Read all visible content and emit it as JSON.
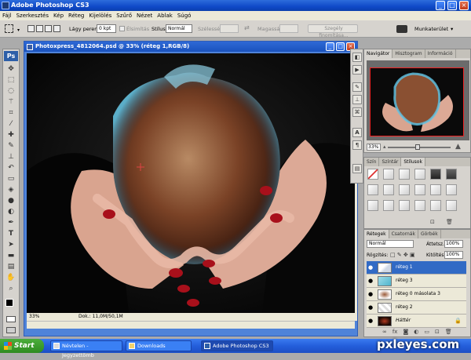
{
  "window": {
    "title": "Adobe Photoshop CS3",
    "minimize": "_",
    "maximize": "□",
    "close": "×"
  },
  "menu": [
    "Fájl",
    "Szerkesztés",
    "Kép",
    "Réteg",
    "Kijelölés",
    "Szűrő",
    "Nézet",
    "Ablak",
    "Súgó"
  ],
  "options": {
    "feather_label": "Lágy perem:",
    "feather_value": "0 kpt",
    "antialias_label": "Élsimítás",
    "style_label": "Stílus:",
    "style_value": "Normál",
    "width_label": "Szélesség:",
    "height_label": "Magasság:",
    "refine_label": "Szegély finomítása...",
    "workspace_label": "Munkaterület"
  },
  "document": {
    "title": "Photoxpress_4812064.psd @ 33% (réteg 1,RGB/8)",
    "zoom": "33%",
    "doc_info": "Dok.: 11,0M/50,1M"
  },
  "navigator": {
    "tabs": [
      "Navigátor",
      "Hisztogram",
      "Információ"
    ],
    "zoom": "33%"
  },
  "styles": {
    "tabs": [
      "Szín",
      "Színtár",
      "Stílusok"
    ]
  },
  "layers": {
    "tabs": [
      "Rétegek",
      "Csatornák",
      "Görbék"
    ],
    "blend_mode": "Normál",
    "opacity_label": "Áttetsz.:",
    "opacity_value": "100%",
    "lock_label": "Rögzítés:",
    "fill_label": "Kitöltés:",
    "fill_value": "100%",
    "items": [
      {
        "name": "réteg 1",
        "selected": true
      },
      {
        "name": "réteg 3",
        "selected": false
      },
      {
        "name": "réteg 0 másolata 3",
        "selected": false
      },
      {
        "name": "réteg 2",
        "selected": false
      },
      {
        "name": "Háttér",
        "selected": false
      }
    ]
  },
  "taskbar": {
    "start": "Start",
    "items": [
      "Névtelen - Jegyzettömb",
      "Downloads",
      "Adobe Photoshop CS3"
    ]
  },
  "watermark": "pxleyes.com",
  "colors": {
    "selection": "#316ac5",
    "xp_blue": "#245edb",
    "panel_bg": "#d6d3ce"
  }
}
